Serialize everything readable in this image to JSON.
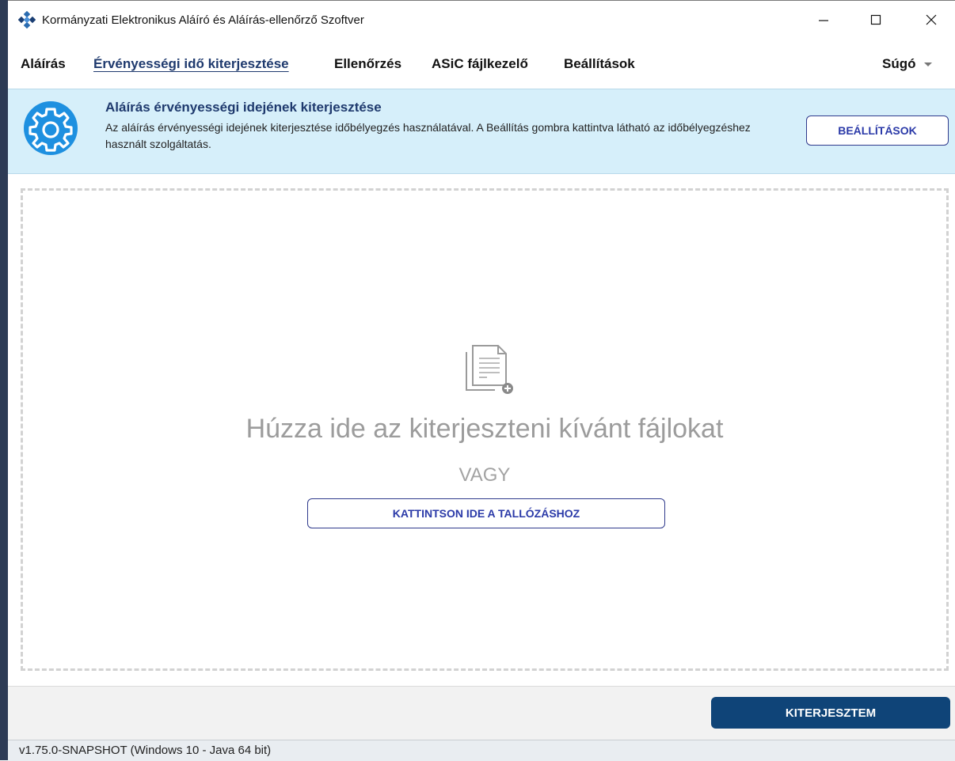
{
  "window": {
    "title": "Kormányzati Elektronikus Aláíró és Aláírás-ellenőrző Szoftver",
    "icon": "app-logo-icon",
    "controls": {
      "minimize": "minimize-icon",
      "maximize": "maximize-icon",
      "close": "close-icon"
    }
  },
  "menu": {
    "items": [
      {
        "label": "Aláírás",
        "active": false
      },
      {
        "label": "Érvényességi idő kiterjesztése",
        "active": true
      },
      {
        "label": "Ellenőrzés",
        "active": false
      },
      {
        "label": "ASiC fájlkezelő",
        "active": false
      },
      {
        "label": "Beállítások",
        "active": false
      }
    ],
    "help": "Súgó"
  },
  "banner": {
    "icon": "gear-icon",
    "title": "Aláírás érvényességi idejének kiterjesztése",
    "description": "Az aláírás érvényességi idejének kiterjesztése időbélyegzés használatával. A Beállítás gombra kattintva látható az időbélyegzéshez használt szolgáltatás.",
    "button": "BEÁLLÍTÁSOK"
  },
  "dropzone": {
    "icon": "add-document-icon",
    "prompt": "Húzza ide az kiterjeszteni kívánt fájlokat",
    "or": "VAGY",
    "browse_button": "KATTINTSON IDE A TALLÓZÁSHOZ"
  },
  "actions": {
    "primary": "KITERJESZTEM"
  },
  "status": {
    "version": "v1.75.0-SNAPSHOT (Windows 10 - Java 64 bit)"
  },
  "colors": {
    "accent": "#1f3a6e",
    "banner_bg": "#d6effa",
    "primary_button": "#0f4478",
    "button_text": "#2b3aa8",
    "banner_icon": "#1e90e0"
  }
}
